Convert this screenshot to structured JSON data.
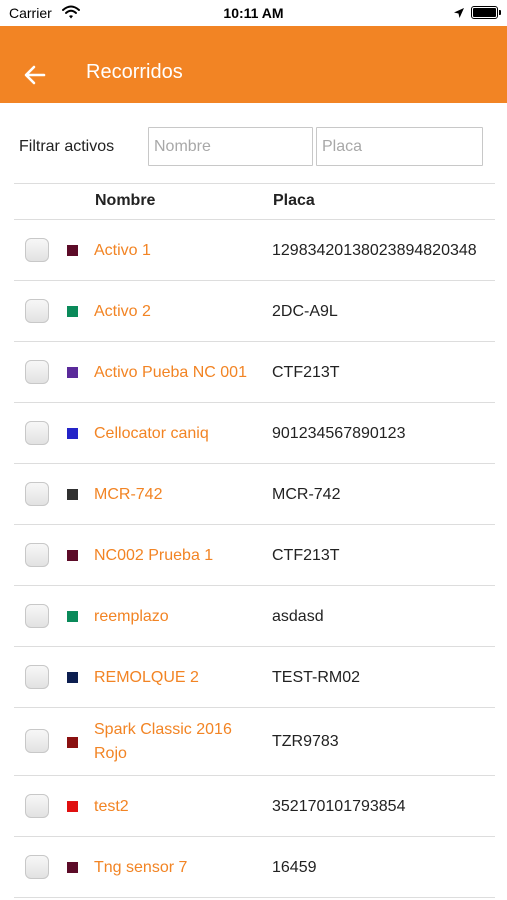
{
  "status_bar": {
    "carrier": "Carrier",
    "time": "10:11 AM",
    "icons": [
      "wifi-icon",
      "location-arrow-icon",
      "battery-icon"
    ]
  },
  "nav": {
    "title": "Recorridos",
    "back_icon": "arrow-left-icon"
  },
  "filter": {
    "label": "Filtrar activos",
    "name_placeholder": "Nombre",
    "plate_placeholder": "Placa"
  },
  "columns": {
    "name": "Nombre",
    "plate": "Placa"
  },
  "colors": {
    "accent": "#f28424"
  },
  "assets": [
    {
      "name": "Activo 1",
      "plate": "12983420138023894820348",
      "color": "#5c0b28",
      "checked": false
    },
    {
      "name": "Activo 2",
      "plate": "2DC-A9L",
      "color": "#0a8a5a",
      "checked": false
    },
    {
      "name": "Activo Pueba NC 001",
      "plate": "CTF213T",
      "color": "#5a2a9a",
      "checked": false
    },
    {
      "name": "Cellocator caniq",
      "plate": "901234567890123",
      "color": "#2424c8",
      "checked": false
    },
    {
      "name": "MCR-742",
      "plate": "MCR-742",
      "color": "#303030",
      "checked": false
    },
    {
      "name": "NC002 Prueba 1",
      "plate": "CTF213T",
      "color": "#5c0b28",
      "checked": false
    },
    {
      "name": "reemplazo",
      "plate": "asdasd",
      "color": "#0a8a5a",
      "checked": false
    },
    {
      "name": "REMOLQUE 2",
      "plate": "TEST-RM02",
      "color": "#0c1e50",
      "checked": false
    },
    {
      "name": "Spark Classic 2016 Rojo",
      "plate": "TZR9783",
      "color": "#8a1010",
      "checked": false
    },
    {
      "name": "test2",
      "plate": "352170101793854",
      "color": "#e01010",
      "checked": false
    },
    {
      "name": "Tng sensor 7",
      "plate": "16459",
      "color": "#5c0b28",
      "checked": false
    }
  ]
}
